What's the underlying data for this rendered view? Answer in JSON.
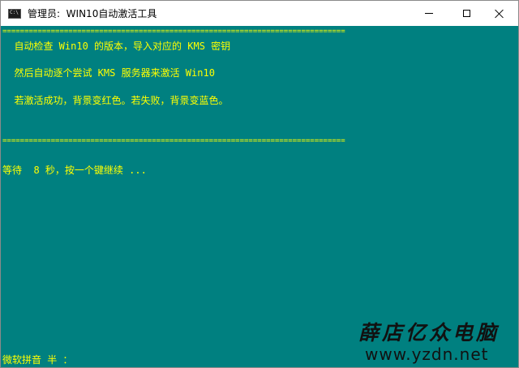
{
  "window": {
    "title": "管理员:  WIN10自动激活工具"
  },
  "console": {
    "separator": "==============================================================================",
    "lines": [
      "  自动检查 Win10 的版本，导入对应的 KMS 密钥",
      "  然后自动逐个尝试 KMS 服务器来激活 Win10",
      "  若激活成功，背景变红色。若失败，背景变蓝色。"
    ],
    "wait_text": "等待  8 秒，按一个键继续 ...",
    "ime_status": "微软拼音 半 ："
  },
  "watermark": {
    "name": "薛店亿众电脑",
    "url": "www.yzdn.net"
  },
  "colors": {
    "background": "#008080",
    "text": "#ffff00",
    "titlebar": "#ffffff"
  }
}
